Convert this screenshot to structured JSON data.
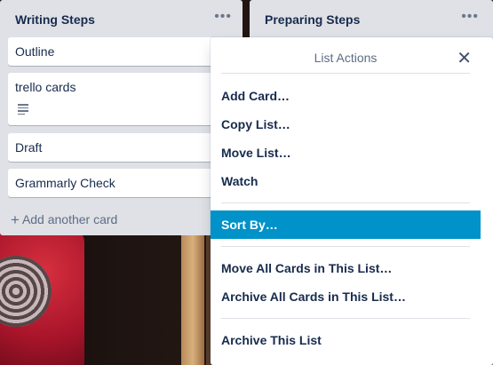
{
  "lists": [
    {
      "title": "Writing Steps",
      "menu_icon": "more-dots-icon",
      "cards": [
        {
          "title": "Outline"
        },
        {
          "title": "trello cards",
          "has_description": true
        },
        {
          "title": "Draft"
        },
        {
          "title": "Grammarly Check"
        }
      ],
      "add_card_label": "Add another card"
    },
    {
      "title": "Preparing Steps",
      "menu_icon": "more-dots-icon"
    }
  ],
  "popover": {
    "title": "List Actions",
    "close_icon": "close-icon",
    "items": [
      {
        "label": "Add Card…"
      },
      {
        "label": "Copy List…"
      },
      {
        "label": "Move List…"
      },
      {
        "label": "Watch"
      },
      {
        "label": "Sort By…",
        "highlighted": true
      },
      {
        "label": "Move All Cards in This List…"
      },
      {
        "label": "Archive All Cards in This List…"
      },
      {
        "label": "Archive This List"
      }
    ]
  },
  "colors": {
    "list_bg": "#dfe1e6",
    "highlight": "#0092c9",
    "text_primary": "#172b4d",
    "text_muted": "#5e6c84"
  }
}
